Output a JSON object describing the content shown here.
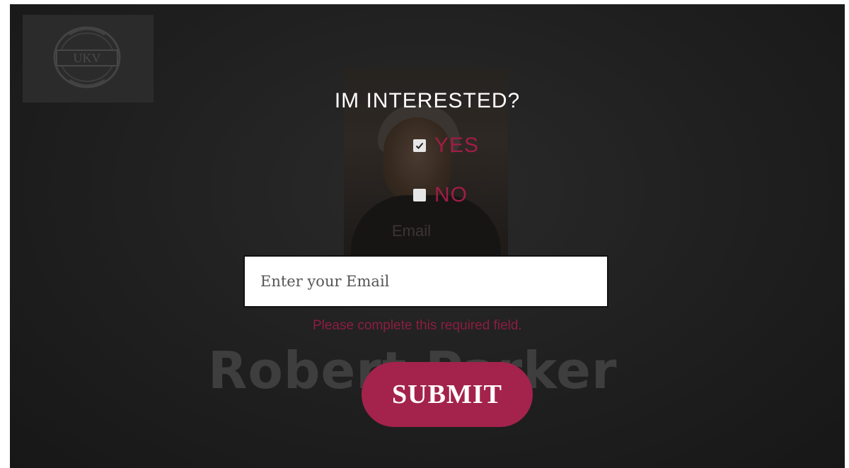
{
  "brand": {
    "logo_text": "UKV",
    "logo_icon": "seal-logo-icon"
  },
  "background": {
    "photo_caption": "Email",
    "name": "Robert Parker"
  },
  "form": {
    "title": "IM INTERESTED?",
    "options": [
      {
        "label": "YES",
        "checked": true
      },
      {
        "label": "NO",
        "checked": false
      }
    ],
    "email_placeholder": "Enter your Email",
    "email_value": "",
    "error_text": "Please complete this required field.",
    "submit_label": "SUBMIT"
  },
  "colors": {
    "accent": "#a3234c",
    "option_text": "#9f1d46",
    "error_text": "#8c1d40",
    "background": "#1f1f1f"
  }
}
